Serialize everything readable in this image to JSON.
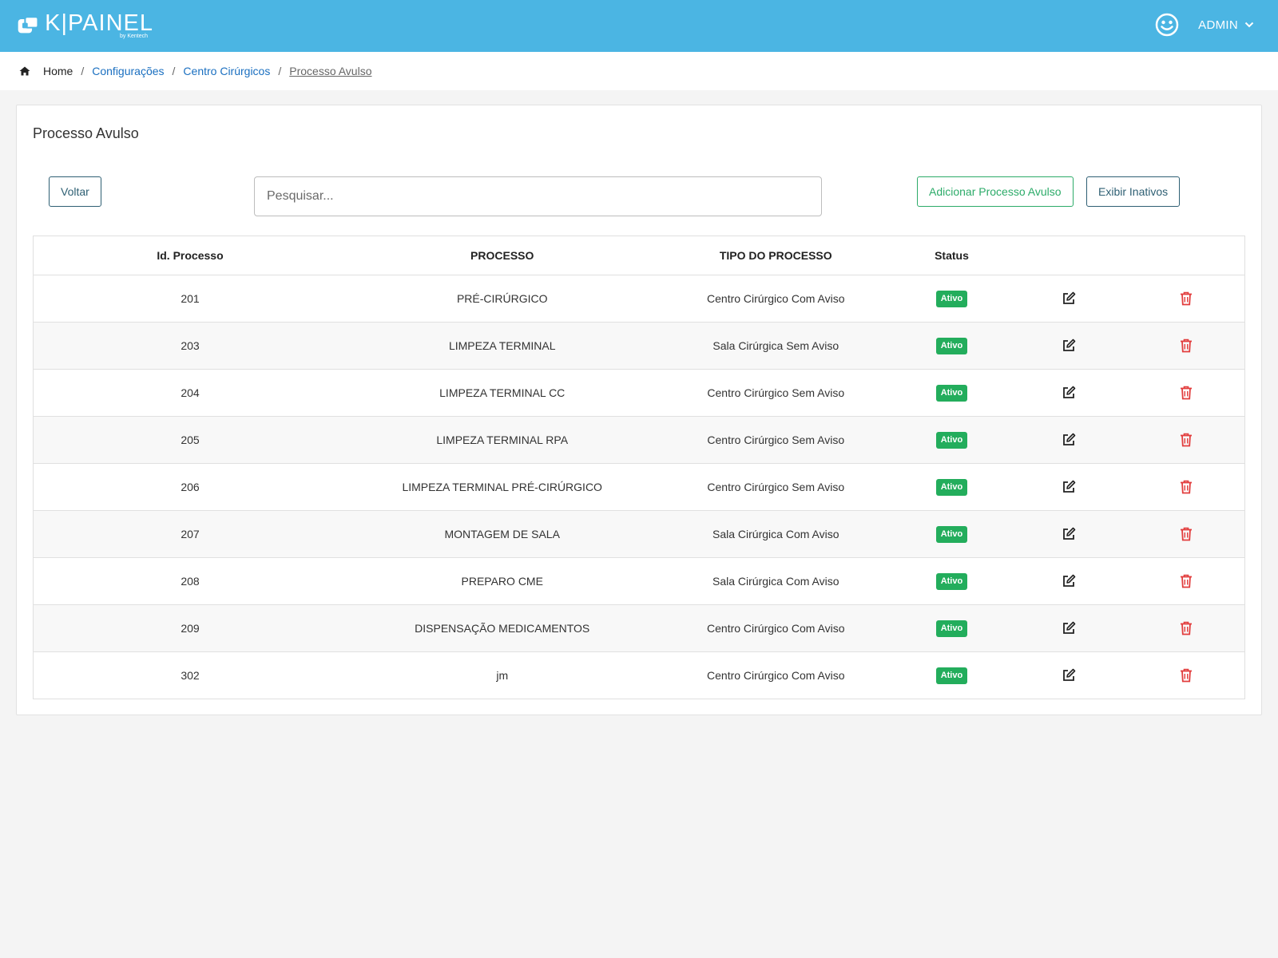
{
  "header": {
    "logo_text": "K|PAINEL",
    "logo_sub": "by Kentech",
    "user_name": "ADMIN",
    "colors": {
      "topbar": "#4bb5e3"
    }
  },
  "breadcrumb": {
    "home": "Home",
    "items": [
      "Configurações",
      "Centro Cirúrgicos"
    ],
    "current": "Processo Avulso",
    "separator": "/"
  },
  "page": {
    "title": "Processo Avulso",
    "back_label": "Voltar",
    "search_placeholder": "Pesquisar...",
    "add_label": "Adicionar Processo Avulso",
    "inactive_label": "Exibir Inativos"
  },
  "table": {
    "columns": [
      "Id. Processo",
      "PROCESSO",
      "TIPO DO PROCESSO",
      "Status",
      "",
      ""
    ],
    "rows": [
      {
        "id": "201",
        "processo": "PRÉ-CIRÚRGICO",
        "tipo": "Centro Cirúrgico Com Aviso",
        "status": "Ativo"
      },
      {
        "id": "203",
        "processo": "LIMPEZA TERMINAL",
        "tipo": "Sala Cirúrgica Sem Aviso",
        "status": "Ativo"
      },
      {
        "id": "204",
        "processo": "LIMPEZA TERMINAL CC",
        "tipo": "Centro Cirúrgico Sem Aviso",
        "status": "Ativo"
      },
      {
        "id": "205",
        "processo": "LIMPEZA TERMINAL RPA",
        "tipo": "Centro Cirúrgico Sem Aviso",
        "status": "Ativo"
      },
      {
        "id": "206",
        "processo": "LIMPEZA TERMINAL PRÉ-CIRÚRGICO",
        "tipo": "Centro Cirúrgico Sem Aviso",
        "status": "Ativo"
      },
      {
        "id": "207",
        "processo": "MONTAGEM DE SALA",
        "tipo": "Sala Cirúrgica Com Aviso",
        "status": "Ativo"
      },
      {
        "id": "208",
        "processo": "PREPARO CME",
        "tipo": "Sala Cirúrgica Com Aviso",
        "status": "Ativo"
      },
      {
        "id": "209",
        "processo": "DISPENSAÇÃO MEDICAMENTOS",
        "tipo": "Centro Cirúrgico Com Aviso",
        "status": "Ativo"
      },
      {
        "id": "302",
        "processo": "jm",
        "tipo": "Centro Cirúrgico Com Aviso",
        "status": "Ativo"
      }
    ],
    "row_icons": [
      "edit-icon",
      "trash-icon"
    ]
  }
}
